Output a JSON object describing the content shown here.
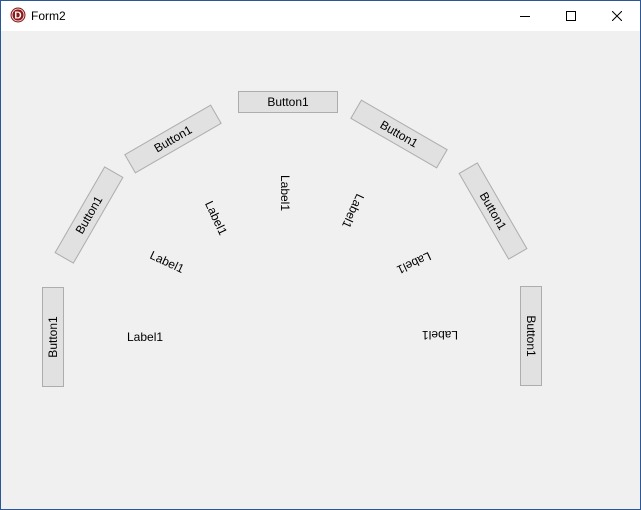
{
  "window": {
    "title": "Form2",
    "icon": "delphi-logo-icon",
    "accent_color": "#8b1a1a",
    "controls": {
      "minimize": "minimize-icon",
      "maximize": "maximize-icon",
      "close": "close-icon"
    }
  },
  "buttons": [
    {
      "caption": "Button1"
    },
    {
      "caption": "Button1"
    },
    {
      "caption": "Button1"
    },
    {
      "caption": "Button1"
    },
    {
      "caption": "Button1"
    },
    {
      "caption": "Button1"
    },
    {
      "caption": "Button1"
    }
  ],
  "labels": [
    {
      "caption": "Label1"
    },
    {
      "caption": "Label1"
    },
    {
      "caption": "Label1"
    },
    {
      "caption": "Label1"
    },
    {
      "caption": "Label1"
    },
    {
      "caption": "Label1"
    },
    {
      "caption": "Label1"
    }
  ]
}
